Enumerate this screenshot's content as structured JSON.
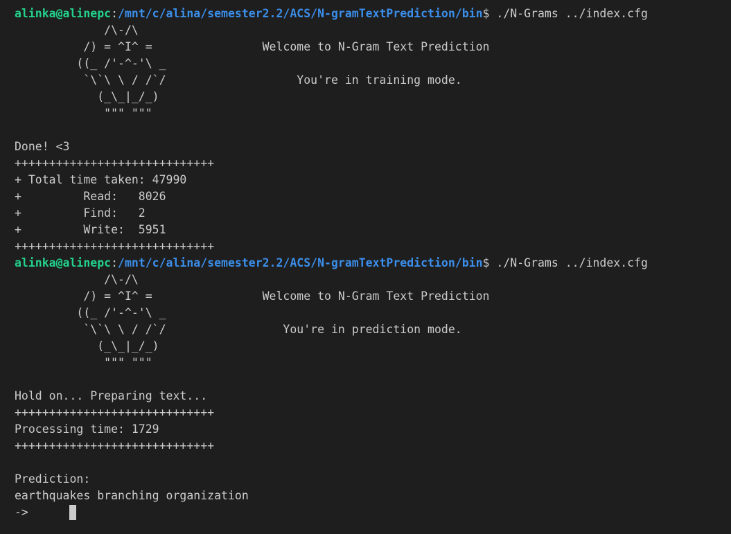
{
  "prompt": {
    "user": "alinka@alinepc",
    "path": "/mnt/c/alina/semester2.2/ACS/N-gramTextPrediction/bin",
    "suffix": "$ ./N-Grams ../index.cfg"
  },
  "lines": [
    {
      "type": "prompt"
    },
    {
      "type": "text",
      "text": "             /\\-/\\"
    },
    {
      "type": "text",
      "text": "          /) = ^I^ =                Welcome to N-Gram Text Prediction"
    },
    {
      "type": "text",
      "text": "         ((_ /'-^-'\\ _"
    },
    {
      "type": "text",
      "text": "          `\\`\\ \\ / /`/                   You're in training mode."
    },
    {
      "type": "text",
      "text": "            (_\\_|_/_)"
    },
    {
      "type": "text",
      "text": "             \"\"\" \"\"\""
    },
    {
      "type": "text",
      "text": ""
    },
    {
      "type": "text",
      "text": "Done! <3"
    },
    {
      "type": "text",
      "text": "+++++++++++++++++++++++++++++"
    },
    {
      "type": "text",
      "text": "+ Total time taken: 47990"
    },
    {
      "type": "text",
      "text": "+         Read:   8026"
    },
    {
      "type": "text",
      "text": "+         Find:   2"
    },
    {
      "type": "text",
      "text": "+         Write:  5951"
    },
    {
      "type": "text",
      "text": "+++++++++++++++++++++++++++++"
    },
    {
      "type": "prompt"
    },
    {
      "type": "text",
      "text": "             /\\-/\\"
    },
    {
      "type": "text",
      "text": "          /) = ^I^ =                Welcome to N-Gram Text Prediction"
    },
    {
      "type": "text",
      "text": "         ((_ /'-^-'\\ _"
    },
    {
      "type": "text",
      "text": "          `\\`\\ \\ / /`/                 You're in prediction mode."
    },
    {
      "type": "text",
      "text": "            (_\\_|_/_)"
    },
    {
      "type": "text",
      "text": "             \"\"\" \"\"\""
    },
    {
      "type": "text",
      "text": ""
    },
    {
      "type": "text",
      "text": "Hold on... Preparing text..."
    },
    {
      "type": "text",
      "text": "+++++++++++++++++++++++++++++"
    },
    {
      "type": "text",
      "text": "Processing time: 1729"
    },
    {
      "type": "text",
      "text": "+++++++++++++++++++++++++++++"
    },
    {
      "type": "text",
      "text": ""
    },
    {
      "type": "text",
      "text": "Prediction:"
    },
    {
      "type": "text",
      "text": "earthquakes branching organization"
    },
    {
      "type": "input",
      "text": "->      "
    }
  ]
}
